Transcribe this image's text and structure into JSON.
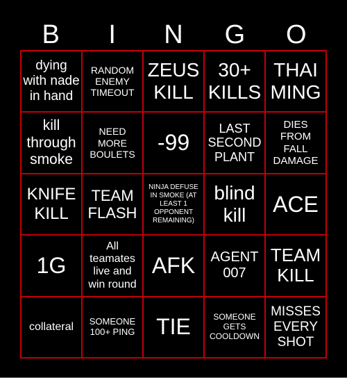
{
  "header": [
    "B",
    "I",
    "N",
    "G",
    "O"
  ],
  "colors": {
    "background": "#000000",
    "border": "#c0000a",
    "text": "#ffffff"
  },
  "cells": [
    "dying with nade in hand",
    "RANDOM ENEMY TIMEOUT",
    "ZEUS KILL",
    "30+ KILLS",
    "THAI MING",
    "kill through smoke",
    "NEED MORE BOULETS",
    "-99",
    "LAST SECOND PLANT",
    "DIES FROM FALL DAMAGE",
    "KNIFE KILL",
    "TEAM FLASH",
    "NINJA DEFUSE IN SMOKE (AT LEAST 1 OPPONENT REMAINING)",
    "blind kill",
    "ACE",
    "1G",
    "All teamates live and win round",
    "AFK",
    "AGENT 007",
    "TEAM KILL",
    "collateral",
    "SOMEONE 100+ PING",
    "TIE",
    "SOMEONE GETS COOLDOWN",
    "MISSES EVERY SHOT"
  ]
}
